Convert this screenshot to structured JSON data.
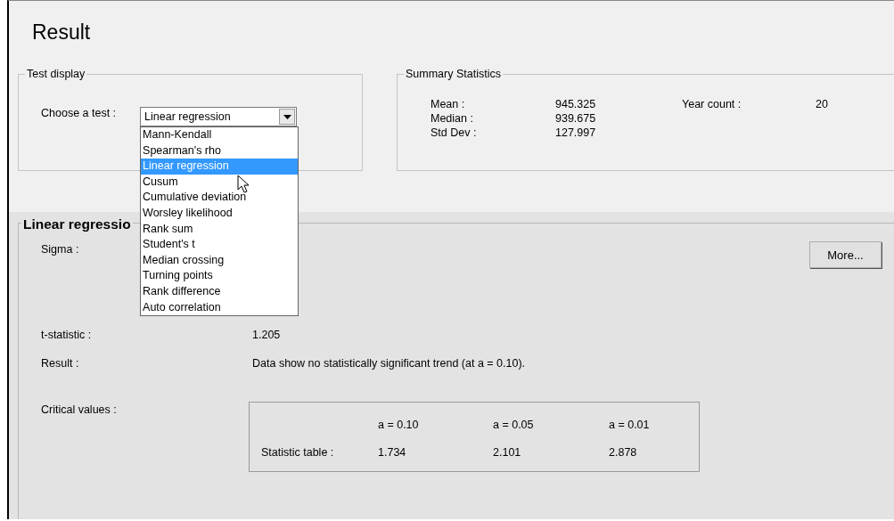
{
  "title": "Result",
  "test_display": {
    "legend": "Test display",
    "label": "Choose a test :",
    "value": "Linear regression",
    "options": [
      {
        "label": "Mann-Kendall",
        "selected": false
      },
      {
        "label": "Spearman's rho",
        "selected": false
      },
      {
        "label": "Linear regression",
        "selected": true
      },
      {
        "label": "Cusum",
        "selected": false
      },
      {
        "label": "Cumulative deviation",
        "selected": false
      },
      {
        "label": "Worsley likelihood",
        "selected": false
      },
      {
        "label": "Rank sum",
        "selected": false
      },
      {
        "label": "Student's t",
        "selected": false
      },
      {
        "label": "Median crossing",
        "selected": false
      },
      {
        "label": "Turning points",
        "selected": false
      },
      {
        "label": "Rank difference",
        "selected": false
      },
      {
        "label": "Auto correlation",
        "selected": false
      }
    ]
  },
  "summary": {
    "legend": "Summary Statistics",
    "stats": [
      {
        "label": "Mean :",
        "value": "945.325"
      },
      {
        "label": "Median :",
        "value": "939.675"
      },
      {
        "label": "Std Dev :",
        "value": "127.997"
      }
    ],
    "year_count": {
      "label": "Year count :",
      "value": "20"
    }
  },
  "result_panel": {
    "heading": "Linear regressio",
    "more_button": "More...",
    "sigma_label": "Sigma  :",
    "t_statistic": {
      "label": "t-statistic :",
      "value": "1.205"
    },
    "result": {
      "label": "Result :",
      "value": "Data show no statistically significant trend (at a = 0.10)."
    },
    "critical": {
      "label": "Critical values :",
      "columns": [
        "a = 0.10",
        "a = 0.05",
        "a = 0.01"
      ],
      "row_label": "Statistic table :",
      "values": [
        "1.734",
        "2.101",
        "2.878"
      ]
    }
  }
}
